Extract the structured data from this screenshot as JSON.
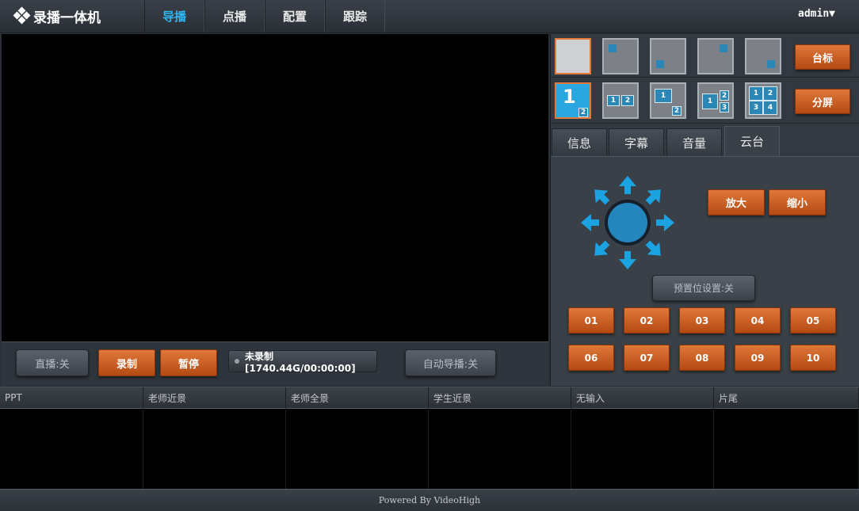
{
  "header": {
    "logo_text": "录播一体机",
    "nav": [
      "导播",
      "点播",
      "配置",
      "跟踪"
    ],
    "active_nav": 0,
    "user": "admin▼"
  },
  "controls": {
    "live": "直播:关",
    "record": "录制",
    "pause": "暂停",
    "rec_status": "未录制[1740.44G/00:00:00]",
    "auto_director": "自动导播:关"
  },
  "right_panel": {
    "layout_button": "台标",
    "split_button": "分屏",
    "tabs": [
      "信息",
      "字幕",
      "音量",
      "云台"
    ],
    "active_tab": 3,
    "zoom_in": "放大",
    "zoom_out": "缩小",
    "preset_setting": "预置位设置:关",
    "presets": [
      "01",
      "02",
      "03",
      "04",
      "05",
      "06",
      "07",
      "08",
      "09",
      "10"
    ],
    "split_labels": {
      "one_main": "1",
      "one_sub": "2",
      "two": [
        "1",
        "2"
      ],
      "pip": [
        "1",
        "2"
      ],
      "three": [
        "1",
        "2",
        "3"
      ],
      "four": [
        "1",
        "2",
        "3",
        "4"
      ]
    }
  },
  "channels": [
    "PPT",
    "老师近景",
    "老师全景",
    "学生近景",
    "无输入",
    "片尾"
  ],
  "footer": "Powered By VideoHigh",
  "colors": {
    "accent_orange": "#d4622a",
    "accent_blue": "#2fb6f0",
    "ptz_blue": "#1aa3e0"
  }
}
